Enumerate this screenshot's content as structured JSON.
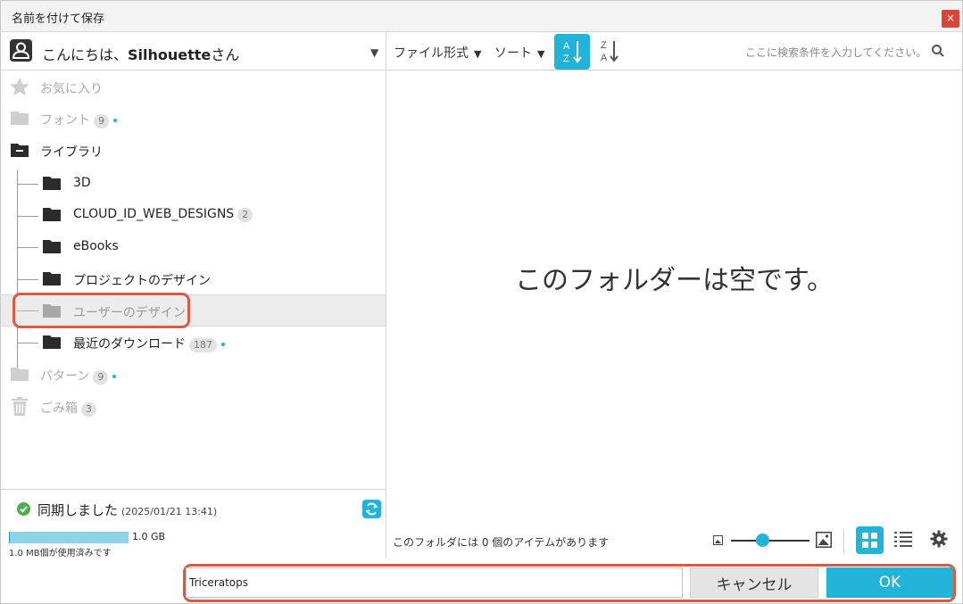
{
  "window": {
    "title": "名前を付けて保存",
    "close_label": "×"
  },
  "user": {
    "greeting_prefix": "こんにちは、",
    "name": "Silhouette",
    "greeting_suffix": "さん",
    "caret": "▼"
  },
  "tree": {
    "favorites": {
      "label": "お気に入り"
    },
    "fonts": {
      "label": "フォント",
      "count": "9"
    },
    "library": {
      "label": "ライブラリ"
    },
    "folders": [
      {
        "label": "3D"
      },
      {
        "label": "CLOUD_ID_WEB_DESIGNS",
        "count": "2"
      },
      {
        "label": "eBooks"
      },
      {
        "label": "プロジェクトのデザイン"
      },
      {
        "label": "ユーザーのデザイン"
      },
      {
        "label": "最近のダウンロード",
        "count": "187"
      }
    ],
    "patterns": {
      "label": "パターン",
      "count": "9"
    },
    "trash": {
      "label": "ごみ箱",
      "count": "3"
    }
  },
  "sync": {
    "status": "同期しました",
    "date": "(2025/01/21 13:41)",
    "total": "1.0 GB",
    "used": "1.0 MB個が使用済みです",
    "used_fraction": 0.01
  },
  "toolbar": {
    "file_type": "ファイル形式",
    "sort": "ソート",
    "caret": "▼",
    "search_placeholder": "ここに検索条件を入力してください。"
  },
  "content": {
    "empty_message": "このフォルダーは空です。",
    "item_count": "このフォルダには 0 個のアイテムがあります",
    "thumbnail_size_fraction": 0.4
  },
  "filename": {
    "value": "Triceratops"
  },
  "buttons": {
    "cancel": "キャンセル",
    "ok": "OK"
  },
  "colors": {
    "accent": "#22b3d8",
    "highlight_outline": "#d95a43",
    "close": "#d9453b"
  }
}
